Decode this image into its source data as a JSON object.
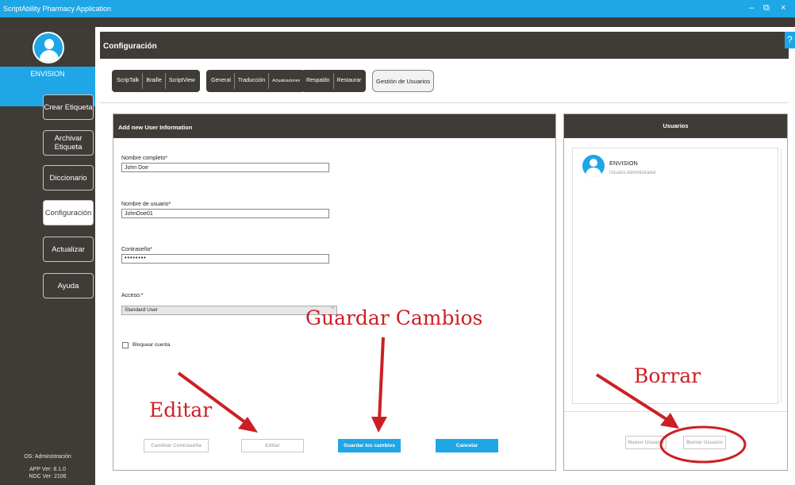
{
  "window": {
    "title": "ScriptAbility Pharmacy Application",
    "minimize": "–",
    "restore": "⧉",
    "close": "×"
  },
  "sidebar": {
    "user": "ENVISION",
    "items": [
      {
        "label": "Crear Etiqueta"
      },
      {
        "label": "Archivar Etiqueta"
      },
      {
        "label": "Diccionario"
      },
      {
        "label": "Configuración",
        "active": true
      },
      {
        "label": "Actualizar"
      },
      {
        "label": "Ayuda"
      }
    ],
    "footer": {
      "os": "OS: Administración",
      "app_ver": "APP Ver: 8.1.0",
      "ndc_ver": "NDC Ver: 2106"
    }
  },
  "header": {
    "title": "Configuración",
    "help": "?"
  },
  "tabs": {
    "group1": [
      "ScripTalk",
      "Braille",
      "ScriptView"
    ],
    "group2": [
      "General",
      "Traducción",
      "Actualizaciones"
    ],
    "group3": [
      "Respaldo",
      "Restaurar"
    ],
    "user_mgmt": "Gestión de Usuarios"
  },
  "form": {
    "header": "Add new User Information",
    "fullname_label": "Nombre completo*",
    "fullname_value": "John Doe",
    "username_label": "Nombre de usuario*",
    "username_value": "JohnDoe01",
    "password_label": "Contraseña*",
    "password_value": "••••••••",
    "access_label": "Acceso:*",
    "access_value": "Standard User",
    "lock_label": "Bloquear cuenta",
    "buttons": {
      "change_password": "Cambiar Contraseña",
      "edit": "Editar",
      "save": "Guardar los cambios",
      "cancel": "Cancelar"
    }
  },
  "users": {
    "header": "Usuarios",
    "list": [
      {
        "name": "ENVISION",
        "role": "Usuario Administrador"
      }
    ],
    "buttons": {
      "new_user": "Nuevo Usuario",
      "delete_user": "Borrar Usuario"
    }
  },
  "annotations": {
    "edit": "Editar",
    "save": "Guardar Cambios",
    "delete": "Borrar",
    "color": "#cc1f25"
  },
  "colors": {
    "accent": "#1ea6e6",
    "dark": "#3f3b37"
  }
}
